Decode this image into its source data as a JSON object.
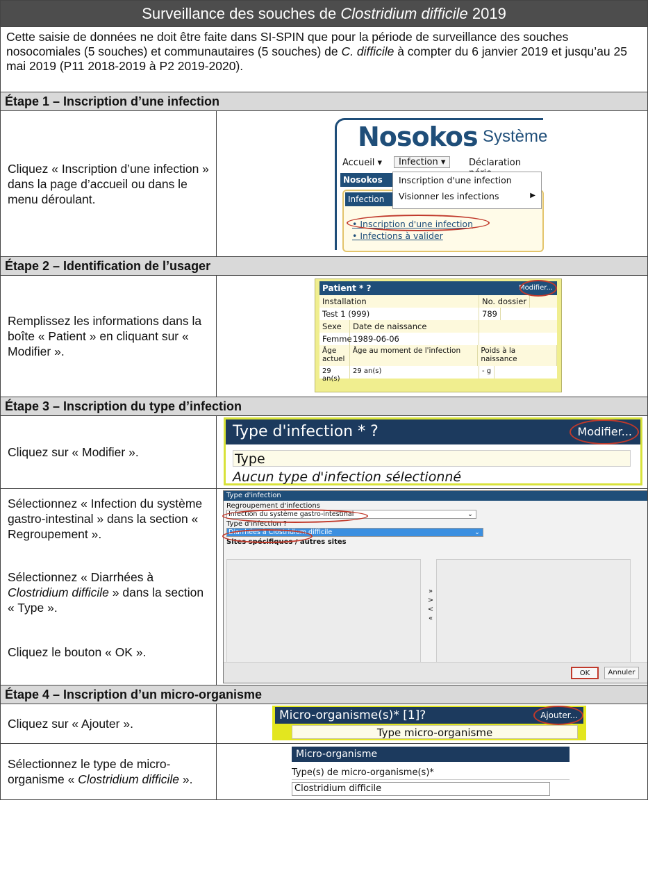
{
  "title": {
    "pre": "Surveillance des souches de ",
    "em": "Clostridium difficile",
    "post": " 2019"
  },
  "intro": {
    "a": "Cette saisie de données ne doit être faite dans SI-SPIN que pour la période de surveillance des souches nosocomiales (5 souches) et communautaires (5 souches) de ",
    "em": "C. difficile",
    "b": " à compter du 6 janvier 2019 et jusqu’au 25 mai 2019 (P11 2018-2019 à P2 2019-2020)."
  },
  "step1": {
    "heading": "Étape 1 – Inscription d’une infection",
    "text": "Cliquez « Inscription d’une infection » dans la page d’accueil ou dans le menu déroulant.",
    "shot": {
      "logo": "Nosokos",
      "system": "Système",
      "menu": [
        "Accueil ▾",
        "Infection ▾",
        "Déclaration pério"
      ],
      "tab": "Nosokos",
      "dropdown": [
        "Inscription d'une infection",
        "Visionner les infections"
      ],
      "panel_title": "Infection",
      "links": [
        "Inscription d'une infection",
        "Infections à valider"
      ]
    }
  },
  "step2": {
    "heading": "Étape 2 – Identification de l’usager",
    "text": "Remplissez les informations dans la boîte « Patient » en cliquant sur « Modifier ».",
    "shot": {
      "title": "Patient * ?",
      "modify": "Modifier...",
      "installation_label": "Installation",
      "dossier_label": "No. dossier",
      "installation": "Test 1 (999)",
      "dossier": "789",
      "sexe_label": "Sexe",
      "naissance_label": "Date de naissance",
      "sexe": "Femme",
      "naissance": "1989-06-06",
      "age_label": "Âge actuel",
      "age_inf_label": "Âge au moment de l'infection",
      "poids_label": "Poids à la naissance",
      "age": "29 an(s)",
      "age_inf": "29 an(s)",
      "poids": "- g"
    }
  },
  "step3": {
    "heading": "Étape 3 – Inscription du type d’infection",
    "text": "Cliquez sur « Modifier ».",
    "shot": {
      "title": "Type d'infection * ?",
      "modify": "Modifier...",
      "type_label": "Type",
      "none": "Aucun type d'infection sélectionné"
    },
    "text2a": "Sélectionnez « Infection du système gastro-intestinal » dans la section « Regroupement ».",
    "text2b_pre": "Sélectionnez « Diarrhées à ",
    "text2b_em": "Clostridium difficile",
    "text2b_post": " » dans la section « Type ».",
    "text2c": "Cliquez le bouton « OK ».",
    "dialog": {
      "title": "Type d'infection",
      "reg_label": "Regroupement d'infections",
      "reg_value": "Infection du système gastro-intestinal",
      "type_label": "Type d'infection ?",
      "type_value": "Diarrhées à Clostridium difficile",
      "sites_label": "Sites spécifiques / autres sites",
      "arrows": [
        "»",
        ">",
        "<",
        "«"
      ],
      "ok": "OK",
      "cancel": "Annuler"
    }
  },
  "step4": {
    "heading": "Étape 4 – Inscription d’un micro-organisme",
    "text": "Cliquez sur « Ajouter ».",
    "shot": {
      "title": "Micro-organisme(s)*  [1]?",
      "add": "Ajouter...",
      "type": "Type micro-organisme"
    },
    "text2_pre": "Sélectionnez le type de micro-organisme « ",
    "text2_em": "Clostridium difficile",
    "text2_post": " ».",
    "shot2": {
      "title": "Micro-organisme",
      "label": "Type(s) de micro-organisme(s)*",
      "value": "Clostridium difficile"
    }
  }
}
